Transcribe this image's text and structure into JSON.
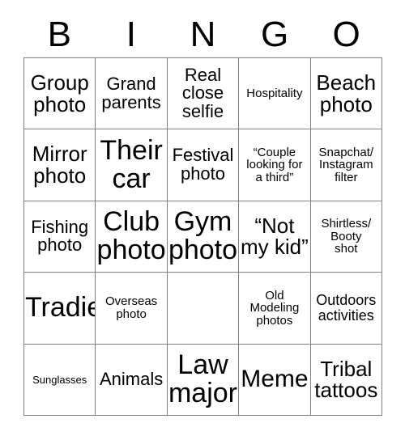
{
  "card": {
    "title": "BINGO",
    "header_letters": [
      "B",
      "I",
      "N",
      "G",
      "O"
    ],
    "grid_size": "5x5",
    "colors": {
      "background": "#ffffff",
      "text": "#000000",
      "border": "#808080"
    },
    "rows": [
      [
        {
          "text": "Group\nphoto",
          "size": "lg"
        },
        {
          "text": "Grand\nparents",
          "size": "md"
        },
        {
          "text": "Real\nclose\nselfie",
          "size": "md"
        },
        {
          "text": "Hospitality",
          "size": "xs"
        },
        {
          "text": "Beach\nphoto",
          "size": "lg"
        }
      ],
      [
        {
          "text": "Mirror\nphoto",
          "size": "lg"
        },
        {
          "text": "Their\ncar",
          "size": "xxl"
        },
        {
          "text": "Festival\nphoto",
          "size": "md"
        },
        {
          "text": "“Couple\nlooking for\na third”",
          "size": "xs"
        },
        {
          "text": "Snapchat/\nInstagram\nfilter",
          "size": "xs"
        }
      ],
      [
        {
          "text": "Fishing\nphoto",
          "size": "md"
        },
        {
          "text": "Club\nphoto",
          "size": "xxl"
        },
        {
          "text": "Gym\nphoto",
          "size": "xxl"
        },
        {
          "text": "“Not\nmy kid”",
          "size": "lg"
        },
        {
          "text": "Shirtless/\nBooty\nshot",
          "size": "xs"
        }
      ],
      [
        {
          "text": "Tradie",
          "size": "xxl"
        },
        {
          "text": "Overseas\nphoto",
          "size": "xs"
        },
        {
          "text": "",
          "size": "md"
        },
        {
          "text": "Old\nModeling\nphotos",
          "size": "xs"
        },
        {
          "text": "Outdoors\nactivities",
          "size": "sm"
        }
      ],
      [
        {
          "text": "Sunglasses",
          "size": "xxs"
        },
        {
          "text": "Animals",
          "size": "md"
        },
        {
          "text": "Law\nmajor",
          "size": "xxl"
        },
        {
          "text": "Meme",
          "size": "xl"
        },
        {
          "text": "Tribal\ntattoos",
          "size": "lg"
        }
      ]
    ]
  }
}
